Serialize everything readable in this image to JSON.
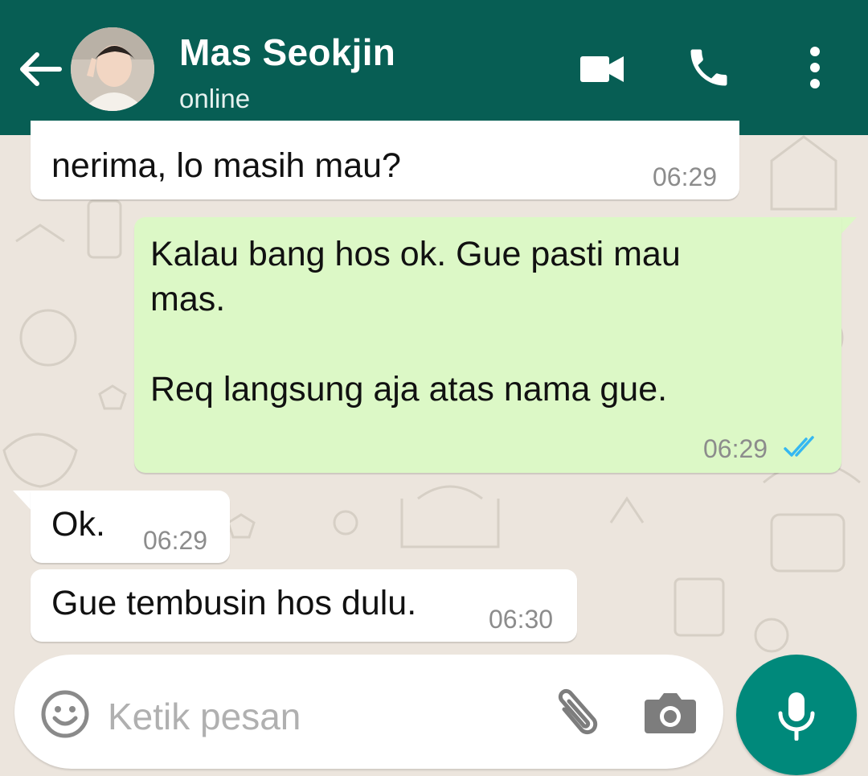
{
  "header": {
    "contact_name": "Mas Seokjin",
    "status": "online",
    "colors": {
      "bar": "#075e54",
      "text": "#ffffff"
    }
  },
  "messages": [
    {
      "direction": "incoming",
      "text": "nerima, lo masih mau?",
      "time": "06:29"
    },
    {
      "direction": "outgoing",
      "text": "Kalau bang hos ok. Gue pasti mau\nmas.\n\nReq langsung aja atas nama gue.",
      "time": "06:29",
      "status": "read"
    },
    {
      "direction": "incoming",
      "text": "Ok.",
      "time": "06:29"
    },
    {
      "direction": "incoming",
      "text": "Gue tembusin hos dulu.",
      "time": "06:30"
    }
  ],
  "composer": {
    "placeholder": "Ketik pesan"
  },
  "icons": {
    "back": "arrow-left-icon",
    "video": "video-call-icon",
    "call": "phone-icon",
    "menu": "more-vertical-icon",
    "emoji": "emoji-icon",
    "attach": "paperclip-icon",
    "camera": "camera-icon",
    "mic": "microphone-icon",
    "read_receipt": "double-check-icon"
  },
  "colors": {
    "wallpaper": "#ece5dd",
    "incoming_bubble": "#ffffff",
    "outgoing_bubble": "#dcf8c6",
    "read_tick": "#34b7f1",
    "mic_button": "#00897b"
  }
}
